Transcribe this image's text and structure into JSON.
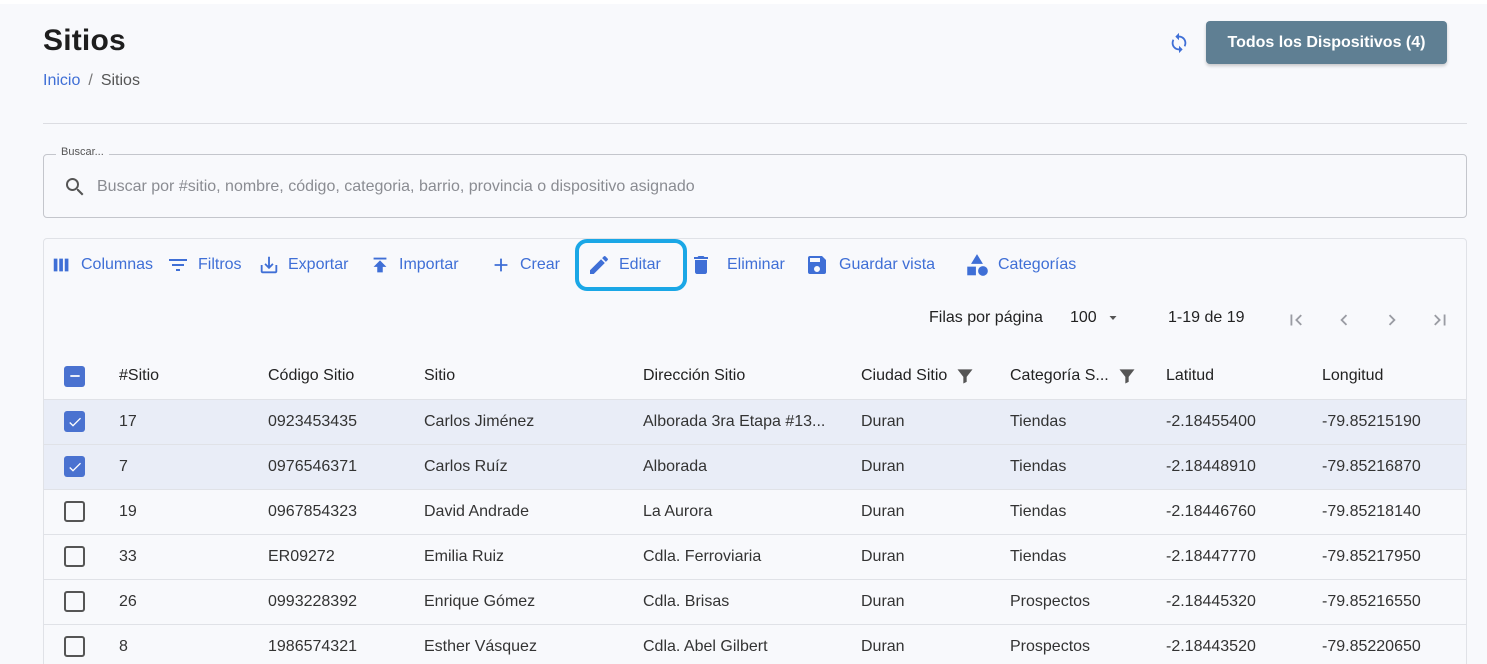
{
  "header": {
    "title": "Sitios",
    "devices_button": "Todos los Dispositivos (4)"
  },
  "breadcrumb": {
    "home": "Inicio",
    "separator": "/",
    "current": "Sitios"
  },
  "search": {
    "legend": "Buscar...",
    "placeholder": "Buscar por #sitio, nombre, código, categoria, barrio, provincia o dispositivo asignado",
    "value": ""
  },
  "toolbar": {
    "columns": "Columnas",
    "filters": "Filtros",
    "export": "Exportar",
    "import": "Importar",
    "create": "Crear",
    "edit": "Editar",
    "delete": "Eliminar",
    "save_view": "Guardar vista",
    "categories": "Categorías"
  },
  "pagination": {
    "rows_per_page_label": "Filas por página",
    "rows_per_page": "100",
    "range": "1-19 de 19"
  },
  "table": {
    "columns": [
      "#Sitio",
      "Código Sitio",
      "Sitio",
      "Dirección Sitio",
      "Ciudad Sitio",
      "Categoría S...",
      "Latitud",
      "Longitud"
    ],
    "rows": [
      {
        "selected": true,
        "cells": [
          "17",
          "0923453435",
          "Carlos Jiménez",
          "Alborada 3ra Etapa #13...",
          "Duran",
          "Tiendas",
          "-2.18455400",
          "-79.85215190"
        ]
      },
      {
        "selected": true,
        "cells": [
          "7",
          "0976546371",
          "Carlos Ruíz",
          "Alborada",
          "Duran",
          "Tiendas",
          "-2.18448910",
          "-79.85216870"
        ]
      },
      {
        "selected": false,
        "cells": [
          "19",
          "0967854323",
          "David Andrade",
          "La Aurora",
          "Duran",
          "Tiendas",
          "-2.18446760",
          "-79.85218140"
        ]
      },
      {
        "selected": false,
        "cells": [
          "33",
          "ER09272",
          "Emilia Ruiz",
          "Cdla. Ferroviaria",
          "Duran",
          "Tiendas",
          "-2.18447770",
          "-79.85217950"
        ]
      },
      {
        "selected": false,
        "cells": [
          "26",
          "0993228392",
          "Enrique Gómez",
          "Cdla. Brisas",
          "Duran",
          "Prospectos",
          "-2.18445320",
          "-79.85216550"
        ]
      },
      {
        "selected": false,
        "cells": [
          "8",
          "1986574321",
          "Esther Vásquez",
          "Cdla. Abel Gilbert",
          "Duran",
          "Prospectos",
          "-2.18443520",
          "-79.85220650"
        ]
      }
    ]
  },
  "colors": {
    "accent": "#3f6fd6",
    "highlight": "#1aa7e6",
    "devices_button": "#5f7f93",
    "selected_row": "#e9edf7"
  }
}
